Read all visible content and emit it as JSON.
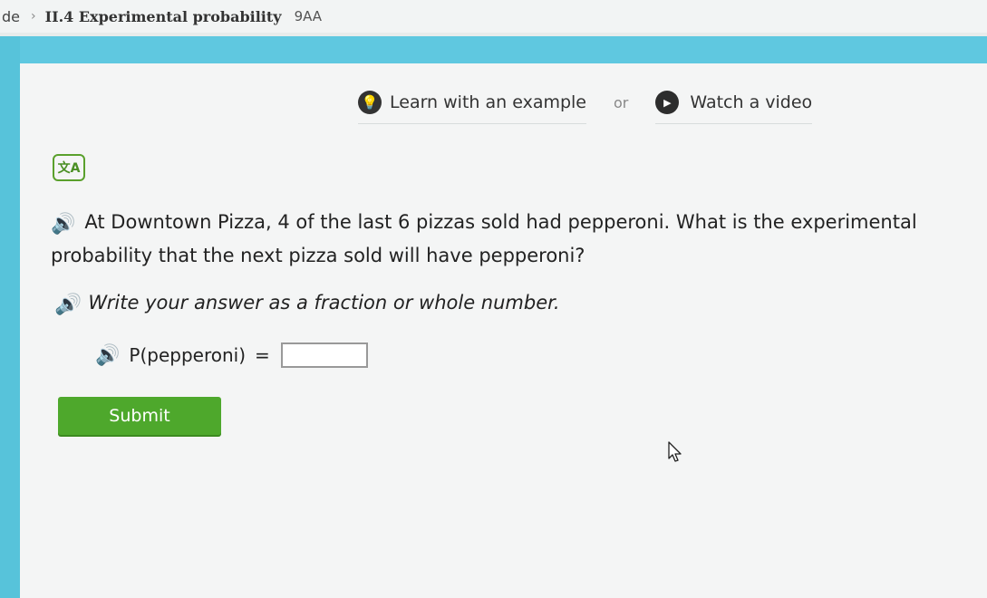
{
  "breadcrumb": {
    "previous": "de",
    "separator": "›",
    "skill": "II.4 Experimental probability",
    "code": "9AA"
  },
  "help": {
    "learn_label": "Learn with an example",
    "or_label": "or",
    "video_label": "Watch a video"
  },
  "question": {
    "text": "At Downtown Pizza, 4 of the last 6 pizzas sold had pepperoni. What is the experimental probability that the next pizza sold will have pepperoni?",
    "instruction": "Write your answer as a fraction or whole number.",
    "answer_label": "P(pepperoni)",
    "equals": "=",
    "answer_value": ""
  },
  "submit_label": "Submit",
  "translate_icon_glyph": "文A",
  "icons": {
    "speaker": "speaker-icon",
    "bulb": "lightbulb-icon",
    "play": "play-icon",
    "translate": "translate-icon",
    "cursor": "mouse-cursor-icon"
  },
  "colors": {
    "accent_blue": "#5fc8e0",
    "submit_green": "#4ea82c",
    "speaker_blue": "#1a5fb4"
  }
}
